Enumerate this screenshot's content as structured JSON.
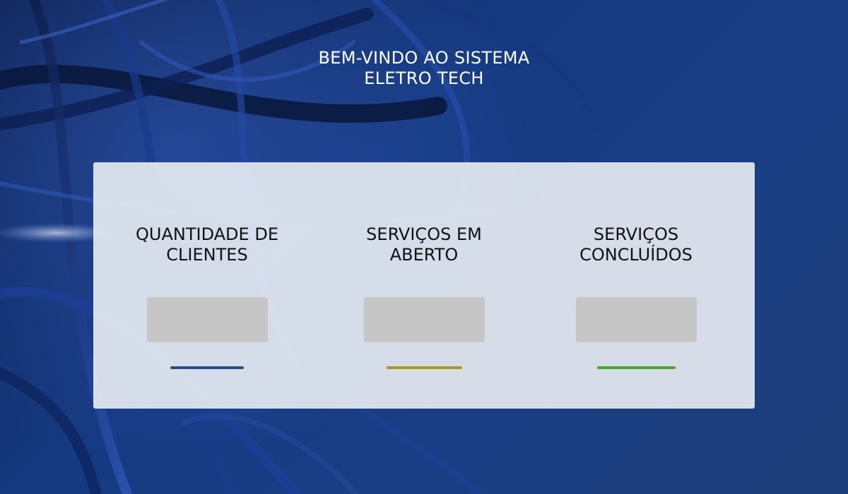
{
  "header": {
    "title_line1": "BEM-VINDO AO SISTEMA",
    "title_line2": "ELETRO TECH"
  },
  "cards": [
    {
      "title_line1": "QUANTIDADE DE",
      "title_line2": "CLIENTES",
      "value": "",
      "accent_color": "#2b4a8c"
    },
    {
      "title_line1": "SERVIÇOS EM",
      "title_line2": "ABERTO",
      "value": "",
      "accent_color": "#a89a1c"
    },
    {
      "title_line1": "SERVIÇOS",
      "title_line2": "CONCLUÍDOS",
      "value": "",
      "accent_color": "#4aa52a"
    }
  ],
  "colors": {
    "background": "#163a82",
    "panel": "#e6eaf2",
    "value_box": "#c6c6c6"
  }
}
